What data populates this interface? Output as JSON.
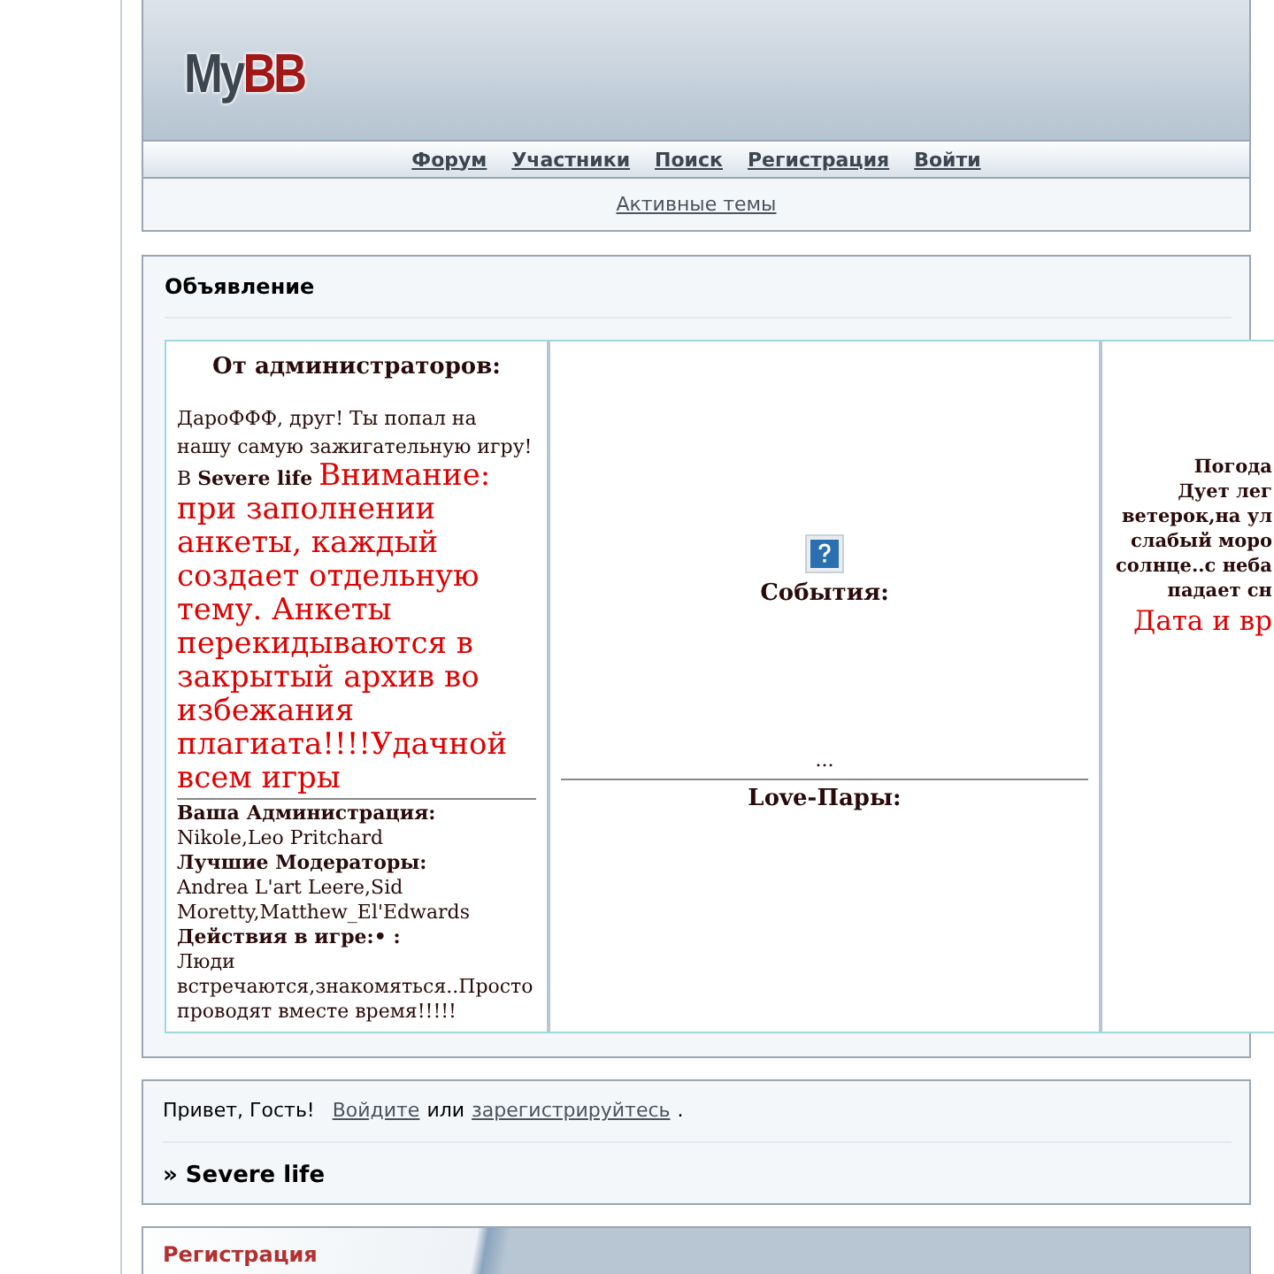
{
  "logo": {
    "first": "My",
    "second": "BB"
  },
  "nav": [
    "Форум",
    "Участники",
    "Поиск",
    "Регистрация",
    "Войти"
  ],
  "active_topics": "Активные темы",
  "announcement": {
    "title": "Объявление",
    "admin_column": {
      "heading": "От администраторов:",
      "intro": "ДароФФФ, друг! Ты попал на нашу самую зажигательную игру! В **Severe life**",
      "notice": "Внимание: при заполнении анкеты, каждый создает отдельную тему. Анкеты перекидываются в закрытый архив во избежания плагиата!!!!Удачной всем игры",
      "sections": [
        {
          "label": "Ваша Администрация:",
          "text": "Nikole,Leo Pritchard"
        },
        {
          "label": "Лучшие Модераторы:",
          "text": "Andrea L'art Leere,Sid Moretty,Matthew_El'Edwards"
        },
        {
          "label": "Действия в игре:• :",
          "text": "Люди встречаются,знакомяться..Просто проводят вместе время!!!!!"
        }
      ]
    },
    "events_column": {
      "heading": "События:",
      "ellipsis": "...",
      "couples_heading": "Love-Пары:"
    },
    "weather_column": {
      "lines": [
        "Погода",
        "Дует лег",
        "ветерок,на ул",
        "слабый моро",
        "солнце..с неба",
        "падает сн"
      ],
      "date": "Дата и вр"
    }
  },
  "greeting": {
    "text": "Привет, Гость!",
    "login_link": "Войдите",
    "or": "или",
    "register_link": "зарегистрируйтесь",
    "dot": ".",
    "breadcrumb": "» Severe life"
  },
  "registration": {
    "title": "Регистрация"
  }
}
